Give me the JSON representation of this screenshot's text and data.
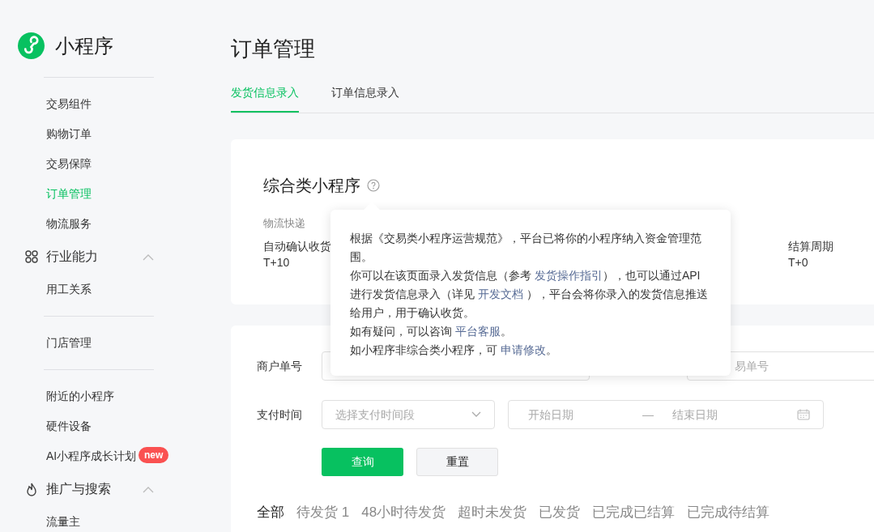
{
  "sidebar": {
    "logo_text": "小程序",
    "entries": [
      {
        "kind": "divider"
      },
      {
        "kind": "item",
        "label": "交易组件",
        "selected": false
      },
      {
        "kind": "item",
        "label": "购物订单",
        "selected": false
      },
      {
        "kind": "item",
        "label": "交易保障",
        "selected": false
      },
      {
        "kind": "item",
        "label": "订单管理",
        "selected": true
      },
      {
        "kind": "item",
        "label": "物流服务",
        "selected": false
      },
      {
        "kind": "section",
        "label": "行业能力",
        "expanded": true
      },
      {
        "kind": "item",
        "label": "用工关系",
        "selected": false
      },
      {
        "kind": "divider"
      },
      {
        "kind": "item",
        "label": "门店管理",
        "selected": false
      },
      {
        "kind": "divider"
      },
      {
        "kind": "item",
        "label": "附近的小程序",
        "selected": false
      },
      {
        "kind": "item",
        "label": "硬件设备",
        "selected": false
      },
      {
        "kind": "item",
        "label": "AI小程序成长计划",
        "selected": false,
        "badge": "new"
      },
      {
        "kind": "section",
        "label": "推广与搜索",
        "expanded": true
      },
      {
        "kind": "item",
        "label": "流量主",
        "selected": false
      }
    ]
  },
  "page_title": "订单管理",
  "tabs": [
    {
      "label": "发货信息录入",
      "selected": true
    },
    {
      "label": "订单信息录入",
      "selected": false
    }
  ],
  "summary": {
    "heading": "综合类小程序",
    "category": "物流快递",
    "fields": [
      {
        "label": "自动确认收货",
        "value": "T+10"
      },
      {
        "label": "结算周期",
        "value": "T+0"
      }
    ]
  },
  "tooltip": {
    "paragraphs": [
      [
        {
          "kind": "text",
          "text": "根据《交易类小程序运营规范》，平台已将你的小程序纳入资金管理范围。"
        }
      ],
      [
        {
          "kind": "text",
          "text": "你可以在该页面录入发货信息（参考 "
        },
        {
          "kind": "link",
          "text": "发货操作指引"
        },
        {
          "kind": "text",
          "text": "），也可以通过API进行发货信息录入（详见 "
        },
        {
          "kind": "link",
          "text": "开发文档"
        },
        {
          "kind": "text",
          "text": " ），平台会将你录入的发货信息推送给用户，用于确认收货。"
        }
      ],
      [
        {
          "kind": "text",
          "text": "如有疑问，可以咨询 "
        },
        {
          "kind": "link",
          "text": "平台客服"
        },
        {
          "kind": "text",
          "text": "。"
        }
      ],
      [
        {
          "kind": "text",
          "text": "如小程序非综合类小程序，可 "
        },
        {
          "kind": "link",
          "text": "申请修改"
        },
        {
          "kind": "text",
          "text": "。"
        }
      ]
    ]
  },
  "filters": {
    "merchant_label": "商户单号",
    "transaction_placeholder": "易单号",
    "pay_time_label": "支付时间",
    "period_placeholder": "选择支付时间段",
    "start_placeholder": "开始日期",
    "range_separator": "—",
    "end_placeholder": "结束日期",
    "query_button": "查询",
    "reset_button": "重置"
  },
  "status_tabs": [
    {
      "label": "全部",
      "selected": true
    },
    {
      "label": "待发货 1",
      "selected": false
    },
    {
      "label": "48小时待发货",
      "selected": false
    },
    {
      "label": "超时未发货",
      "selected": false
    },
    {
      "label": "已发货",
      "selected": false
    },
    {
      "label": "已完成已结算",
      "selected": false
    },
    {
      "label": "已完成待结算",
      "selected": false
    }
  ]
}
